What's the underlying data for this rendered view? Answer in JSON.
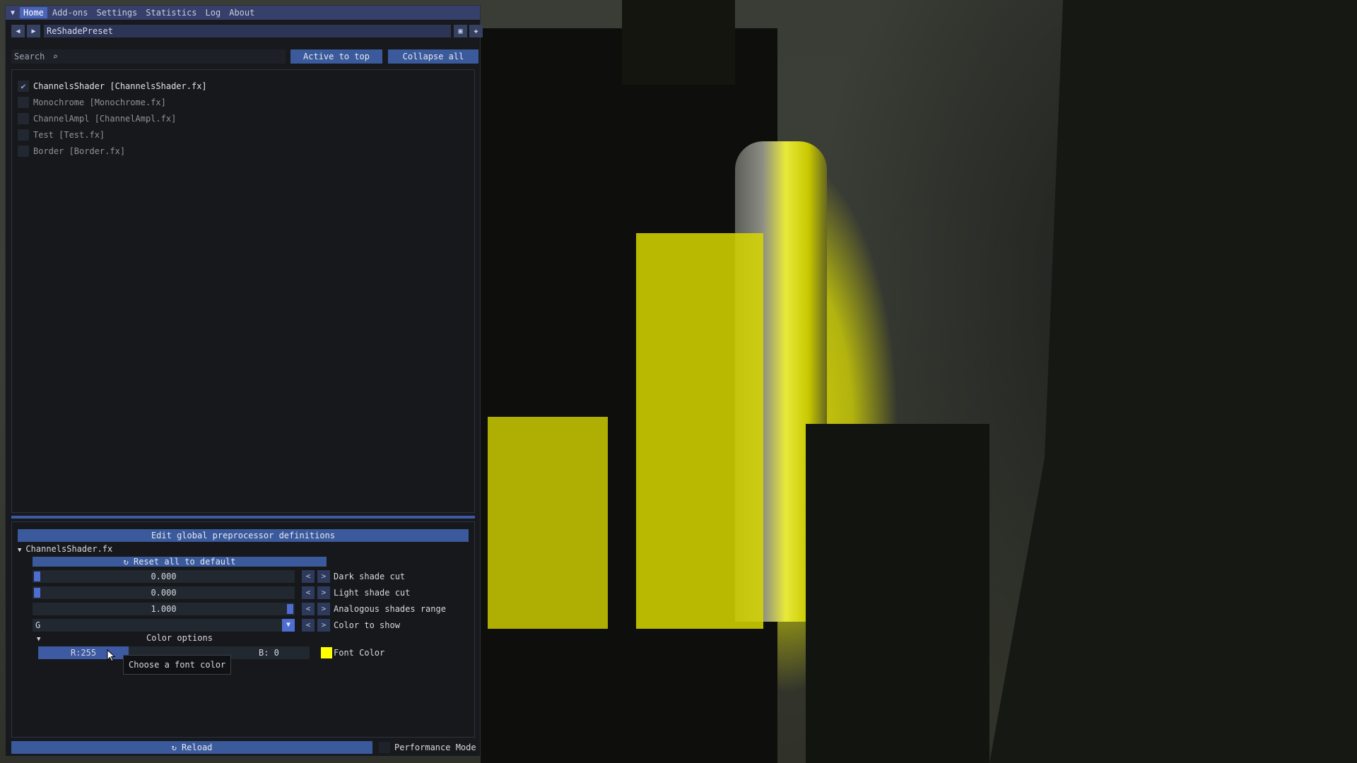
{
  "menu": {
    "items": [
      "Home",
      "Add-ons",
      "Settings",
      "Statistics",
      "Log",
      "About"
    ],
    "active": "Home"
  },
  "preset": {
    "name": "ReShadePreset",
    "prev_icon": "triangle-left-icon",
    "next_icon": "triangle-right-icon",
    "save_icon": "save-icon",
    "add_icon": "plus-icon"
  },
  "toolbar": {
    "search_placeholder": "Search",
    "active_to_top": "Active to top",
    "collapse_all": "Collapse all"
  },
  "effects": [
    {
      "label": "ChannelsShader [ChannelsShader.fx]",
      "enabled": true
    },
    {
      "label": "Monochrome [Monochrome.fx]",
      "enabled": false
    },
    {
      "label": "ChannelAmpl [ChannelAmpl.fx]",
      "enabled": false
    },
    {
      "label": "Test [Test.fx]",
      "enabled": false
    },
    {
      "label": "Border [Border.fx]",
      "enabled": false
    }
  ],
  "params": {
    "edit_global": "Edit global preprocessor definitions",
    "fx_header": "ChannelsShader.fx",
    "reset_all": "Reset all to default",
    "rows": [
      {
        "label": "Dark shade cut",
        "value": "0.000",
        "fraction": 0.0
      },
      {
        "label": "Light shade cut",
        "value": "0.000",
        "fraction": 0.0
      },
      {
        "label": "Analogous shades range",
        "value": "1.000",
        "fraction": 1.0
      }
    ],
    "color_to_show": {
      "label": "Color to show",
      "value": "G"
    },
    "color_options": "Color options",
    "font_color": {
      "label": "Font Color",
      "r": "R:255",
      "b": "B:  0",
      "hex": "#FFFF00"
    },
    "tooltip": "Choose a font color"
  },
  "footer": {
    "reload": "Reload",
    "performance_mode": "Performance Mode"
  },
  "colors": {
    "accent": "#3A5A9C",
    "menubar": "#36406A",
    "window_bg": "#17191D",
    "swatch": "#FFFF00"
  }
}
